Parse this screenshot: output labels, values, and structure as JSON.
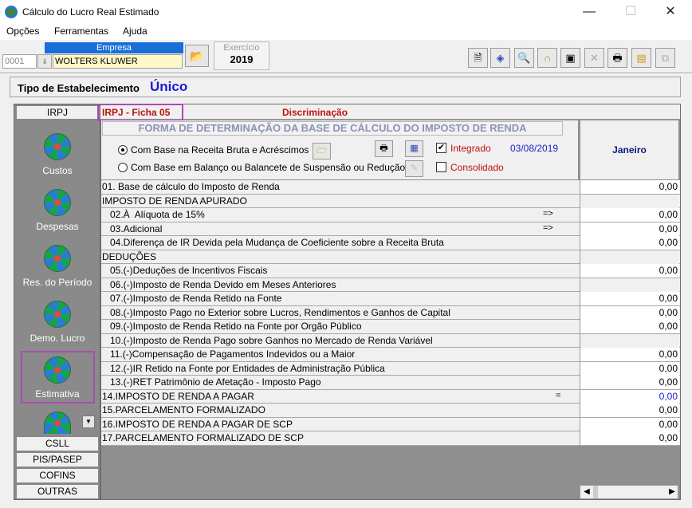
{
  "window": {
    "title": "Cálculo do Lucro Real Estimado",
    "minimize": "—",
    "maximize": "☐",
    "close": "✕"
  },
  "menu": [
    "Opções",
    "Ferramentas",
    "Ajuda"
  ],
  "header": {
    "empresa_label": "Empresa",
    "code": "0001",
    "company": "WOLTERS KLUWER",
    "exercicio_label": "Exercício",
    "exercicio_year": "2019"
  },
  "toolbar_icons": [
    "document-icon",
    "diamond-icon",
    "search-icon",
    "lock-icon",
    "save-icon",
    "delete-icon",
    "print-icon",
    "folders-icon",
    "window-icon"
  ],
  "establishment": {
    "label": "Tipo de Estabelecimento",
    "value": "Único"
  },
  "sidebar": {
    "top_tab": "IRPJ",
    "items": [
      "Custos",
      "Despesas",
      "Res. do Período",
      "Demo. Lucro",
      "Estimativa"
    ],
    "bottom_tabs": [
      "CSLL",
      "PIS/PASEP",
      "COFINS",
      "OUTRAS"
    ]
  },
  "ficha": {
    "label": "IRPJ - Ficha 05",
    "discriminacao": "Discriminação"
  },
  "form": {
    "title": "FORMA DE DETERMINAÇÃO DA BASE DE CÁLCULO DO IMPOSTO DE RENDA",
    "option1": "Com Base na  Receita Bruta e Acréscimos",
    "option2": "Com Base em Balanço ou Balancete de Suspensão ou Redução",
    "integrado": "Integrado",
    "consolidado": "Consolidado",
    "date": "03/08/2019",
    "month": "Janeiro"
  },
  "rows": [
    {
      "desc": "01. Base de cálculo do Imposto de Renda",
      "arrow": "",
      "value": "0,00"
    },
    {
      "desc": "IMPOSTO DE RENDA APURADO",
      "arrow": "",
      "value": ""
    },
    {
      "desc": "   02.À  Alíquota de 15%",
      "arrow": "=>",
      "value": "0,00"
    },
    {
      "desc": "   03.Adicional",
      "arrow": "=>",
      "value": "0,00"
    },
    {
      "desc": "   04.Diferença de IR Devida pela Mudança de Coeficiente sobre a Receita Bruta",
      "arrow": "",
      "value": "0,00"
    },
    {
      "desc": "DEDUÇÕES",
      "arrow": "",
      "value": ""
    },
    {
      "desc": "   05.(-)Deduções de Incentivos Fiscais",
      "arrow": "",
      "value": "0,00"
    },
    {
      "desc": "   06.(-)Imposto de Renda Devido em Meses Anteriores",
      "arrow": "",
      "value": ""
    },
    {
      "desc": "   07.(-)Imposto de Renda Retido na Fonte",
      "arrow": "",
      "value": "0,00"
    },
    {
      "desc": "   08.(-)Imposto Pago no Exterior sobre Lucros, Rendimentos e Ganhos de Capital",
      "arrow": "",
      "value": "0,00"
    },
    {
      "desc": "   09.(-)Imposto de Renda Retido na Fonte por Orgão Público",
      "arrow": "",
      "value": "0,00"
    },
    {
      "desc": "   10.(-)Imposto de Renda Pago sobre Ganhos no Mercado de Renda Variável",
      "arrow": "",
      "value": ""
    },
    {
      "desc": "   11.(-)Compensação de Pagamentos Indevidos ou a Maior",
      "arrow": "",
      "value": "0,00"
    },
    {
      "desc": "   12.(-)IR Retido na Fonte por Entidades de Administração Pública",
      "arrow": "",
      "value": "0,00"
    },
    {
      "desc": "   13.(-)RET Patrimônio de Afetação - Imposto Pago",
      "arrow": "",
      "value": "0,00"
    },
    {
      "desc": "14.IMPOSTO DE RENDA A PAGAR",
      "arrow": "=",
      "value": "0,00",
      "highlight": true
    },
    {
      "desc": "15.PARCELAMENTO FORMALIZADO",
      "arrow": "",
      "value": "0,00"
    },
    {
      "desc": "16.IMPOSTO DE RENDA A PAGAR DE SCP",
      "arrow": "",
      "value": "0,00"
    },
    {
      "desc": "17.PARCELAMENTO FORMALIZADO DE SCP",
      "arrow": "",
      "value": "0,00"
    }
  ],
  "colors": {
    "accent_blue": "#1a6ed8",
    "red_label": "#c01010",
    "highlight_box": "#a94cb2",
    "value_blue": "#1a1ad8"
  }
}
